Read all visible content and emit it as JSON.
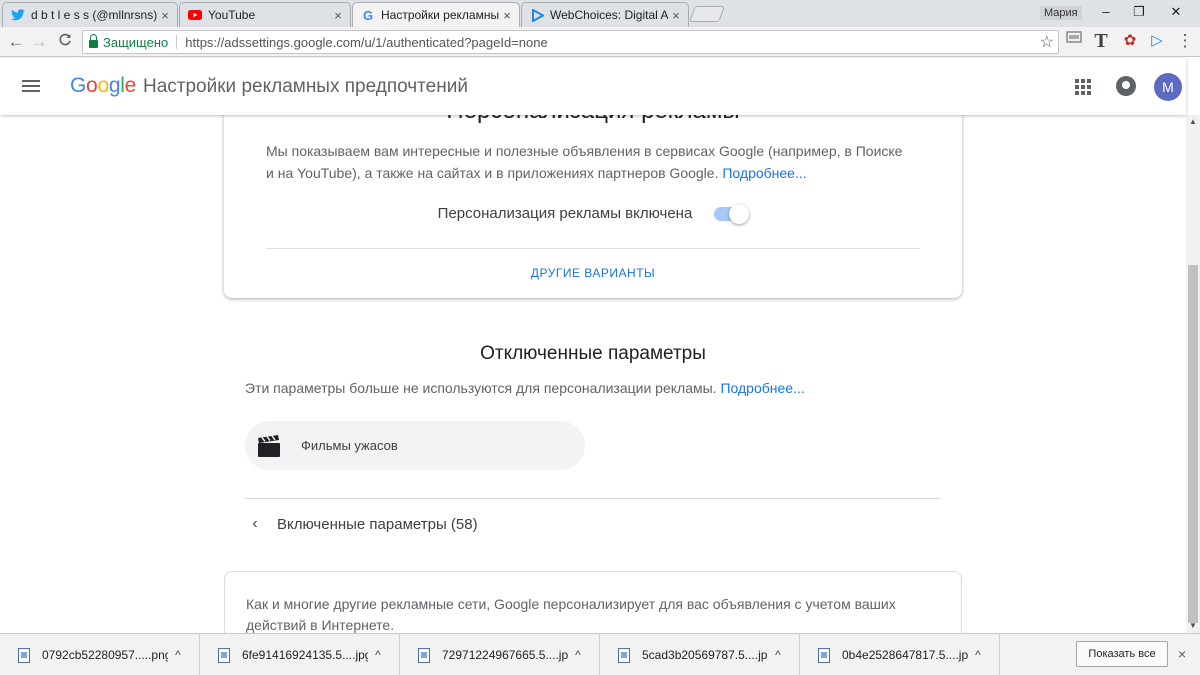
{
  "browser": {
    "tabs": [
      {
        "label": "d b t l e s s (@mllnrsns) |",
        "icon": "twitter-icon",
        "close": "×"
      },
      {
        "label": "YouTube",
        "icon": "youtube-icon",
        "close": "×"
      },
      {
        "label": "Настройки рекламных п",
        "icon": "google-g-icon",
        "close": "×"
      },
      {
        "label": "WebChoices: Digital Adve",
        "icon": "webchoices-icon",
        "close": "×"
      }
    ],
    "user_name": "Мария",
    "window_controls": {
      "minimize": "–",
      "maximize": "❐",
      "close": "✕"
    },
    "nav": {
      "back": "←",
      "forward": "→",
      "reload": "C"
    },
    "security_label": "Защищено",
    "url": "https://adssettings.google.com/u/1/authenticated?pageId=none",
    "bookmark_star": "☆",
    "extensions": [
      "T",
      "✿",
      "▷",
      "⋮"
    ]
  },
  "header": {
    "logo": {
      "G": "G",
      "o1": "o",
      "o2": "o",
      "g": "g",
      "l": "l",
      "e": "e"
    },
    "title": "Настройки рекламных предпочтений",
    "avatar_letter": "M"
  },
  "personalization_card": {
    "title": "Персонализация рекламы",
    "description": "Мы показываем вам интересные и полезные объявления в сервисах Google (например, в Поиске и на YouTube), а также на сайтах и в приложениях партнеров Google.",
    "more_link": "Подробнее...",
    "toggle_label": "Персонализация рекламы включена",
    "toggle_on": true,
    "other_options_button": "ДРУГИЕ ВАРИАНТЫ"
  },
  "disabled_section": {
    "title": "Отключенные параметры",
    "description": "Эти параметры больше не используются для персонализации рекламы.",
    "more_link": "Подробнее...",
    "items": [
      {
        "label": "Фильмы ужасов",
        "icon": "clapperboard-icon"
      }
    ]
  },
  "enabled_section": {
    "label": "Включенные параметры (58)",
    "chevron": "‹"
  },
  "info_card": {
    "text": "Как и многие другие рекламные сети, Google персонализирует для вас объявления с учетом ваших действий в Интернете."
  },
  "downloads": {
    "items": [
      {
        "name": "0792cb52280957.....png"
      },
      {
        "name": "6fe91416924135.5....jpg"
      },
      {
        "name": "72971224967665.5....jpg"
      },
      {
        "name": "5cad3b20569787.5....jpg"
      },
      {
        "name": "0b4e2528647817.5....jpg"
      }
    ],
    "caret": "^",
    "show_all": "Показать все",
    "close": "×"
  },
  "colors": {
    "accent": "#1a73e8",
    "secure": "#0b8043",
    "avatar": "#5c6bc0",
    "toggle_track": "#a8c7fa"
  }
}
